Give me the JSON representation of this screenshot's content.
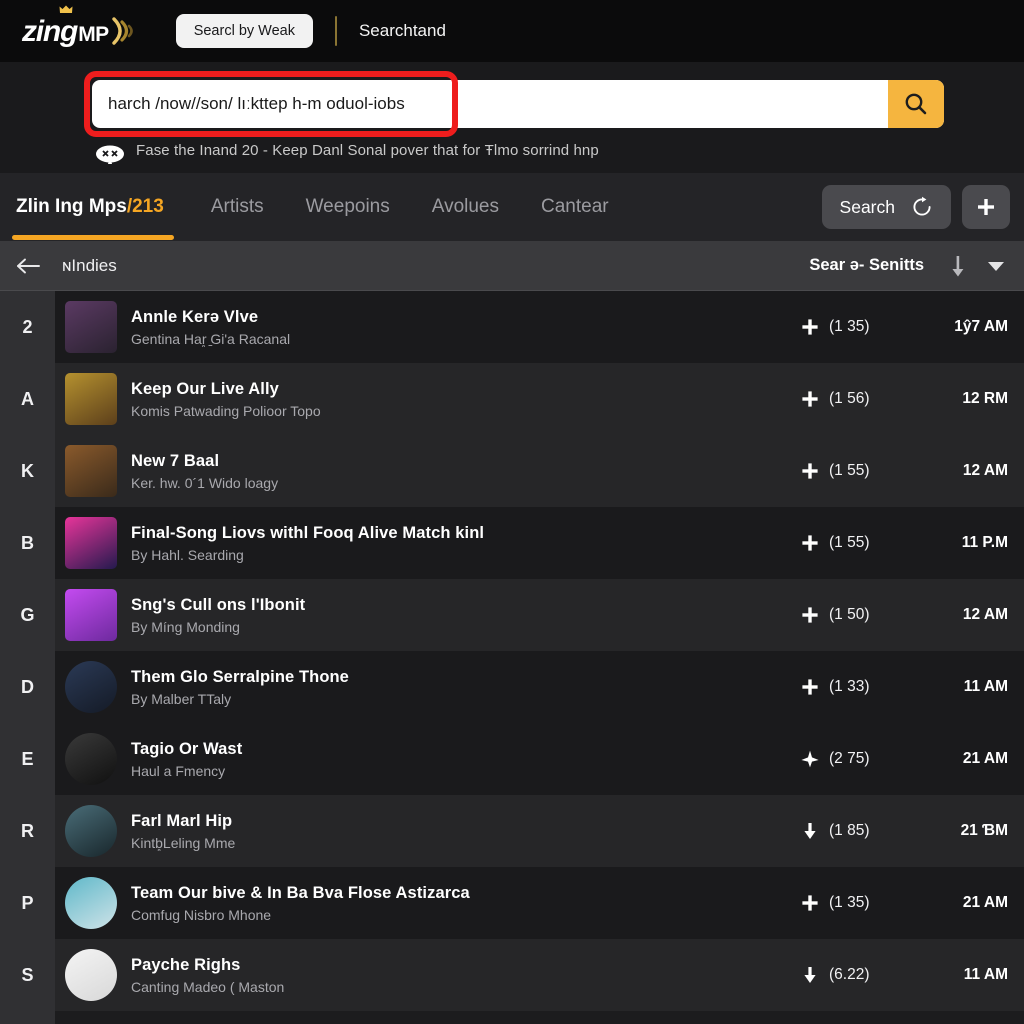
{
  "topbar": {
    "logo_main": "zing",
    "logo_sub": "MP",
    "pill_label": "Searcl by Weak",
    "link_label": "Searchtand"
  },
  "search": {
    "value": "harch /now//son/ lıːkttep h-m oduol-iobs",
    "placeholder": "Search",
    "go_icon": "search-icon",
    "mask_icon": "mask-icon",
    "subtitle": "Fase the Inand 20 - Keep Danl Sonal pover that for Ŧlmo sorrind hnp",
    "highlight_color": "#ee1d1d",
    "go_color": "#f5b53f"
  },
  "nav": {
    "tabs": [
      {
        "label": "Zlin Ing Mps",
        "count": "/213",
        "active": true
      },
      {
        "label": "Artists",
        "active": false
      },
      {
        "label": "Weepoins",
        "active": false
      },
      {
        "label": "Avolues",
        "active": false
      },
      {
        "label": "Cantear",
        "active": false
      }
    ],
    "search_button": "Search",
    "refresh_icon": "refresh-icon",
    "add_icon": "plus-icon",
    "accent_color": "#f5a623"
  },
  "subheader": {
    "back_icon": "back-arrow-icon",
    "breadcrumb": "ɴIndies",
    "sort_label": "Sear ə- Senitts",
    "sort_icon": "sort-descending-icon",
    "caret_icon": "chevron-down-icon"
  },
  "rail": {
    "letters": [
      "2",
      "A",
      "K",
      "B",
      "G",
      "D",
      "E",
      "R",
      "P",
      "S"
    ]
  },
  "list": {
    "rows": [
      {
        "title": "Annle Kerə Vlve",
        "artist": "Gentina Har̥ ̱Giʹa Racanal",
        "icon": "plus-icon",
        "count": "(1 35)",
        "time": "1ŷ7 AM",
        "thumb_shape": "square",
        "thumb_a": "#5b3a63",
        "thumb_b": "#2a2230",
        "shade": "dark"
      },
      {
        "title": "Keep Our Live Ally",
        "artist": "Komis Patwading Polioor Topo",
        "icon": "plus-icon",
        "count": "(1 56)",
        "time": "12 RM",
        "thumb_shape": "square",
        "thumb_a": "#b5912f",
        "thumb_b": "#5c3f1b",
        "shade": "alt"
      },
      {
        "title": "New 7 Baal",
        "artist": "Ker. hw. 0´1 Wido loagy",
        "icon": "plus-icon",
        "count": "(1 55)",
        "time": "12 AM",
        "thumb_shape": "square",
        "thumb_a": "#8a5a2c",
        "thumb_b": "#3a2a1a",
        "shade": "alt"
      },
      {
        "title": "Final-Song Liovs withl Fooq Alive Match kinl",
        "artist": "By Hahl. Searding",
        "icon": "plus-icon",
        "count": "(1 55)",
        "time": "11 P.M",
        "thumb_shape": "square",
        "thumb_a": "#e8359a",
        "thumb_b": "#241a4e",
        "shade": "dark"
      },
      {
        "title": "Sng's Cull ons l'Ibonit",
        "artist": "By Míng Monding",
        "icon": "plus-icon",
        "count": "(1 50)",
        "time": "12 AM",
        "thumb_shape": "square",
        "thumb_a": "#c44bf0",
        "thumb_b": "#6d2a9e",
        "shade": "alt"
      },
      {
        "title": "Them Glo Serralpine Thone",
        "artist": "By Malber TTaly",
        "icon": "plus-icon",
        "count": "(1 33)",
        "time": "11 AM",
        "thumb_shape": "round",
        "thumb_a": "#2b3a56",
        "thumb_b": "#141a26",
        "shade": "dark"
      },
      {
        "title": "Tagio Or Wast",
        "artist": "Haul a Fmency",
        "icon": "airplane-icon",
        "count": "(2 75)",
        "time": "21 AM",
        "thumb_shape": "round",
        "thumb_a": "#3a3a3a",
        "thumb_b": "#101010",
        "shade": "dark"
      },
      {
        "title": "Farl Marl Hip",
        "artist": "Kintb̥Leling Mme",
        "icon": "download-icon",
        "count": "(1 85)",
        "time": "21 ƁM",
        "thumb_shape": "round",
        "thumb_a": "#4a6d78",
        "thumb_b": "#18262b",
        "shade": "alt"
      },
      {
        "title": "Team Our bive & In Ba Bva Flose Astizarca",
        "artist": "Comfug Nisbro Mhone",
        "icon": "plus-icon",
        "count": "(1 35)",
        "time": "21 AM",
        "thumb_shape": "round",
        "thumb_a": "#5fb8c9",
        "thumb_b": "#cfe3e8",
        "shade": "dark"
      },
      {
        "title": "Payche Righs",
        "artist": "Canting Madeo ( Maston",
        "icon": "download-icon",
        "count": "(6.22)",
        "time": "11 AM",
        "thumb_shape": "round",
        "thumb_a": "#f4f4f4",
        "thumb_b": "#d8d8d8",
        "shade": "alt"
      }
    ]
  }
}
